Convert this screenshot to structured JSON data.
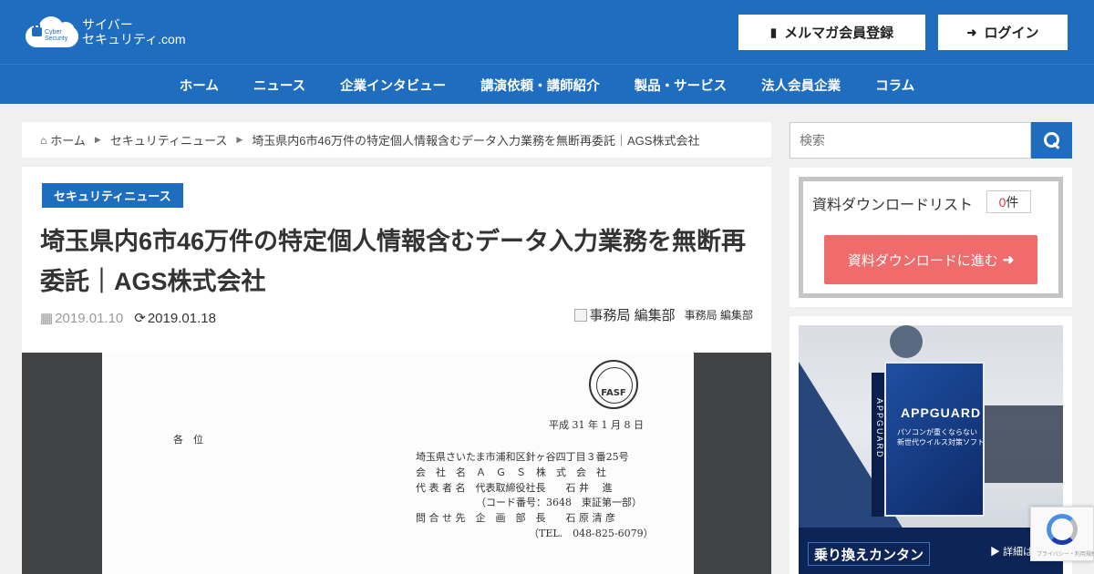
{
  "header": {
    "logo_small": "Cyber\nSecurity",
    "logo_line1": "サイバー",
    "logo_line2": "セキュリティ.com",
    "mail_button": "メルマガ会員登録",
    "login_button": "ログイン",
    "bg_color": "#1e6dbf"
  },
  "nav": {
    "items": [
      {
        "label": "ホーム"
      },
      {
        "label": "ニュース"
      },
      {
        "label": "企業インタビュー"
      },
      {
        "label": "講演依頼・講師紹介"
      },
      {
        "label": "製品・サービス"
      },
      {
        "label": "法人会員企業"
      },
      {
        "label": "コラム"
      }
    ]
  },
  "breadcrumb": {
    "home": "ホーム",
    "category": "セキュリティニュース",
    "current": "埼玉県内6市46万件の特定個人情報含むデータ入力業務を無断再委託｜AGS株式会社"
  },
  "article": {
    "category": "セキュリティニュース",
    "title": "埼玉県内6市46万件の特定個人情報含むデータ入力業務を無断再委託｜AGS株式会社",
    "posted_date": "2019.01.10",
    "updated_date": "2019.01.18",
    "author_img_alt": "事務局 編集部",
    "author_name": "事務局 編集部"
  },
  "document": {
    "logo": "FASF",
    "date": "平成 31 年 1 月 8 日",
    "addressee": "各　位",
    "address": "埼玉県さいたま市浦和区針ヶ谷四丁目３番25号",
    "company": "会　社　名　Ａ　Ｇ　Ｓ　株　式　会　社",
    "representative": "代 表 者 名　代表取締役社長　　石 井　 進",
    "code": "（コード番号：3648　東証第一部）",
    "contact": "問 合 せ 先　企　画　部　長　　石 原 清 彦",
    "tel": "（TEL.　048-825-6079）"
  },
  "sidebar": {
    "search_placeholder": "検索",
    "download_list_title": "資料ダウンロードリスト",
    "download_count": "0",
    "download_count_unit": "件",
    "download_button": "資料ダウンロードに進む",
    "ad": {
      "brand": "APPGUARD",
      "brand_vertical": "APPGUARD",
      "sub_line1": "パソコンが重くならない",
      "sub_line2": "新世代ウイルス対策ソフト",
      "banner": "乗り換えカンタン",
      "more": "▶ 詳細はこ"
    }
  },
  "recaptcha": {
    "text": "プライバシー・利用規約"
  }
}
